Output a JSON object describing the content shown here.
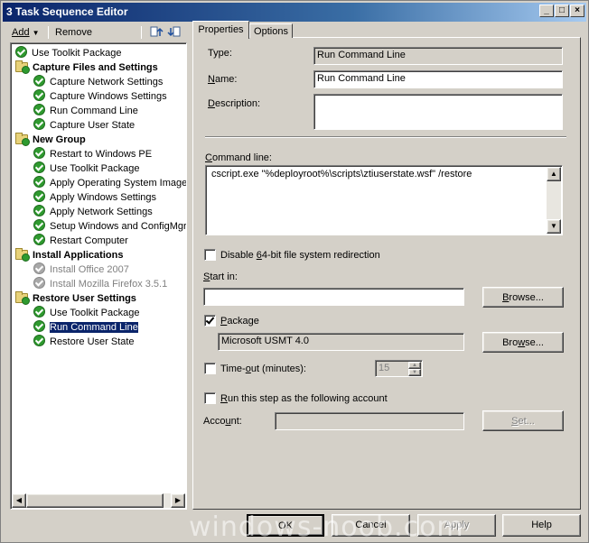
{
  "window": {
    "title": "3 Task Sequence Editor"
  },
  "toolbar": {
    "add_label": "Add",
    "remove_label": "Remove",
    "move_up_icon": "move-up-icon",
    "move_down_icon": "move-down-icon"
  },
  "tree": {
    "items": [
      {
        "label": "Use Toolkit Package",
        "type": "step"
      },
      {
        "label": "Capture Files and Settings",
        "type": "group"
      },
      {
        "label": "Capture Network Settings",
        "type": "step"
      },
      {
        "label": "Capture Windows Settings",
        "type": "step"
      },
      {
        "label": "Run Command Line",
        "type": "step"
      },
      {
        "label": "Capture User State",
        "type": "step"
      },
      {
        "label": "New Group",
        "type": "group"
      },
      {
        "label": "Restart to Windows PE",
        "type": "step"
      },
      {
        "label": "Use Toolkit Package",
        "type": "step"
      },
      {
        "label": "Apply Operating System Image",
        "type": "step"
      },
      {
        "label": "Apply Windows Settings",
        "type": "step"
      },
      {
        "label": "Apply Network Settings",
        "type": "step"
      },
      {
        "label": "Setup Windows and ConfigMgr",
        "type": "step"
      },
      {
        "label": "Restart Computer",
        "type": "step"
      },
      {
        "label": "Install Applications",
        "type": "group"
      },
      {
        "label": "Install Office 2007",
        "type": "step-disabled"
      },
      {
        "label": "Install Mozilla Firefox 3.5.1",
        "type": "step-disabled"
      },
      {
        "label": "Restore User Settings",
        "type": "group"
      },
      {
        "label": "Use Toolkit Package",
        "type": "step"
      },
      {
        "label": "Run Command Line",
        "type": "step-selected"
      },
      {
        "label": "Restore User State",
        "type": "step"
      }
    ]
  },
  "tabs": [
    {
      "label": "Properties",
      "active": true
    },
    {
      "label": "Options",
      "active": false
    }
  ],
  "properties": {
    "type_label": "Type:",
    "type_value": "Run Command Line",
    "name_label": "Name:",
    "name_value": "Run Command Line",
    "description_label": "Description:",
    "description_value": "",
    "command_line_label": "Command line:",
    "command_line_value": "cscript.exe \"%deployroot%\\scripts\\ztiuserstate.wsf\" /restore",
    "disable_redirection_label": "Disable 64-bit file system redirection",
    "disable_redirection_checked": false,
    "start_in_label": "Start in:",
    "start_in_value": "",
    "browse_label": "Browse...",
    "package_label": "Package",
    "package_checked": true,
    "package_value": "Microsoft USMT 4.0",
    "timeout_label": "Time-out (minutes):",
    "timeout_checked": false,
    "timeout_value": "15",
    "run_as_label": "Run this step as the following account",
    "run_as_checked": false,
    "account_label": "Account:",
    "account_value": "",
    "set_label": "Set..."
  },
  "buttons": {
    "ok": "OK",
    "cancel": "Cancel",
    "apply": "Apply",
    "help": "Help"
  },
  "watermark": "windows-noob.com"
}
